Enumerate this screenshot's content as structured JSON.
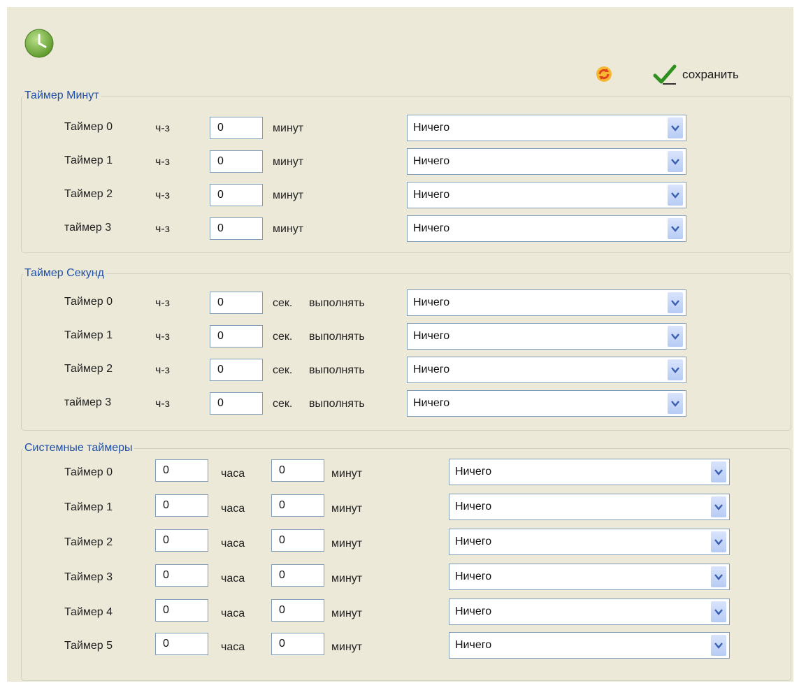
{
  "toolbar": {
    "save_label": "сохранить",
    "app_icon": "clock-icon",
    "refresh_icon": "refresh-icon",
    "save_icon": "checkmark-icon"
  },
  "minutes_group": {
    "legend": "Таймер Минут",
    "rows": [
      {
        "name": "Таймер 0",
        "every": "ч-з",
        "value": "0",
        "unit": "минут",
        "action": "Ничего"
      },
      {
        "name": "Таймер 1",
        "every": "ч-з",
        "value": "0",
        "unit": "минут",
        "action": "Ничего"
      },
      {
        "name": "Таймер 2",
        "every": "ч-з",
        "value": "0",
        "unit": "минут",
        "action": "Ничего"
      },
      {
        "name": "таймер 3",
        "every": "ч-з",
        "value": "0",
        "unit": "минут",
        "action": "Ничего"
      }
    ]
  },
  "seconds_group": {
    "legend": "Таймер Секунд",
    "rows": [
      {
        "name": "Таймер 0",
        "every": "ч-з",
        "value": "0",
        "unit": "сек.",
        "exec": "выполнять",
        "action": "Ничего"
      },
      {
        "name": "Таймер 1",
        "every": "ч-з",
        "value": "0",
        "unit": "сек.",
        "exec": "выполнять",
        "action": "Ничего"
      },
      {
        "name": "Таймер 2",
        "every": "ч-з",
        "value": "0",
        "unit": "сек.",
        "exec": "выполнять",
        "action": "Ничего"
      },
      {
        "name": "таймер 3",
        "every": "ч-з",
        "value": "0",
        "unit": "сек.",
        "exec": "выполнять",
        "action": "Ничего"
      }
    ]
  },
  "system_group": {
    "legend": "Системные таймеры",
    "rows": [
      {
        "name": "Таймер 0",
        "hours": "0",
        "hours_unit": "часа",
        "minutes": "0",
        "minutes_unit": "минут",
        "action": "Ничего"
      },
      {
        "name": "Таймер 1",
        "hours": "0",
        "hours_unit": "часа",
        "minutes": "0",
        "minutes_unit": "минут",
        "action": "Ничего"
      },
      {
        "name": "Таймер 2",
        "hours": "0",
        "hours_unit": "часа",
        "minutes": "0",
        "minutes_unit": "минут",
        "action": "Ничего"
      },
      {
        "name": "Таймер 3",
        "hours": "0",
        "hours_unit": "часа",
        "minutes": "0",
        "minutes_unit": "минут",
        "action": "Ничего"
      },
      {
        "name": "Таймер 4",
        "hours": "0",
        "hours_unit": "часа",
        "minutes": "0",
        "minutes_unit": "минут",
        "action": "Ничего"
      },
      {
        "name": "Таймер 5",
        "hours": "0",
        "hours_unit": "часа",
        "minutes": "0",
        "minutes_unit": "минут",
        "action": "Ничего"
      }
    ]
  },
  "colors": {
    "panel_bg": "#ece9d8",
    "legend_text": "#1f4fa8",
    "input_border": "#7f9db9"
  }
}
